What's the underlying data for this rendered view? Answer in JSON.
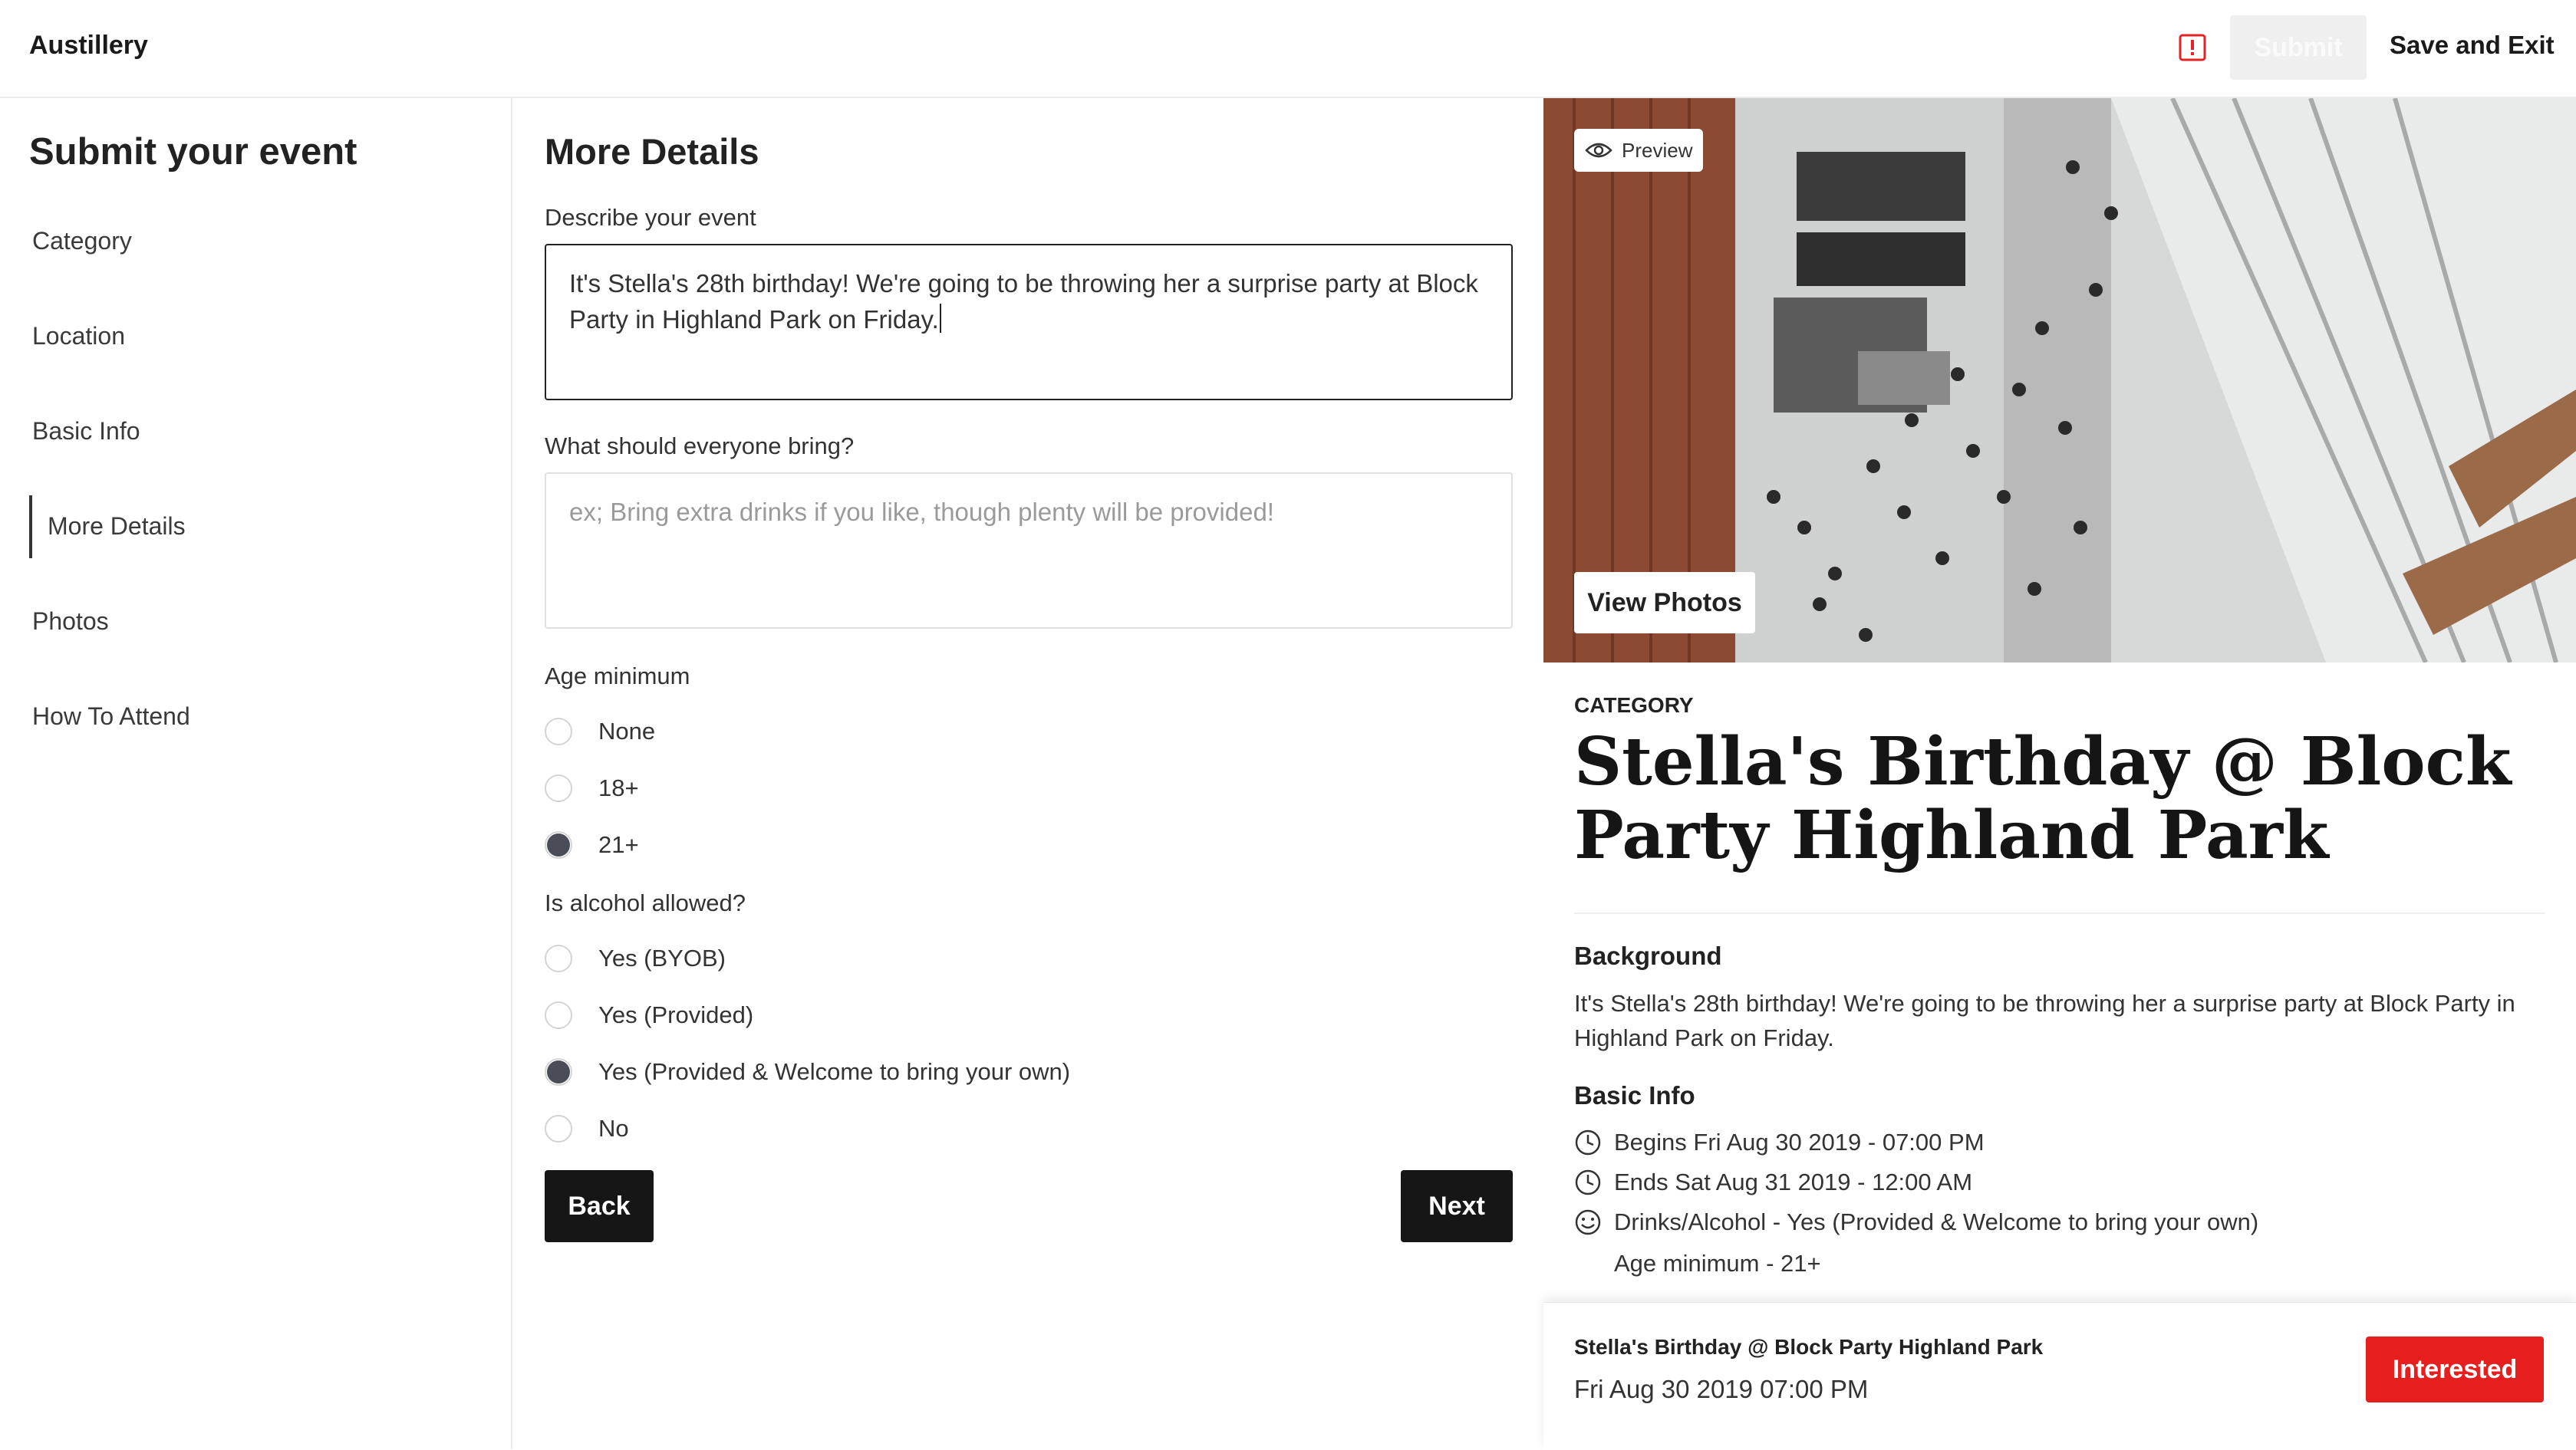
{
  "app": {
    "brand": "Austillery"
  },
  "header": {
    "submit_label": "Submit",
    "save_exit_label": "Save and Exit"
  },
  "sidebar": {
    "title": "Submit your event",
    "items": [
      {
        "label": "Category"
      },
      {
        "label": "Location"
      },
      {
        "label": "Basic Info"
      },
      {
        "label": "More Details",
        "active": true
      },
      {
        "label": "Photos"
      },
      {
        "label": "How To Attend"
      }
    ]
  },
  "form": {
    "heading": "More Details",
    "describe_label": "Describe your event",
    "describe_value": "It's Stella's 28th birthday! We're going to be throwing her a surprise party at Block Party in Highland Park on Friday.",
    "bring_label": "What should everyone bring?",
    "bring_placeholder": "ex; Bring extra drinks if you like, though plenty will be provided!",
    "age_label": "Age minimum",
    "age_options": [
      "None",
      "18+",
      "21+"
    ],
    "age_selected": "21+",
    "alcohol_label": "Is alcohol allowed?",
    "alcohol_options": [
      "Yes (BYOB)",
      "Yes (Provided)",
      "Yes (Provided & Welcome to bring your own)",
      "No"
    ],
    "alcohol_selected": "Yes (Provided & Welcome to bring your own)",
    "back_label": "Back",
    "next_label": "Next"
  },
  "preview": {
    "chip_label": "Preview",
    "view_photos_label": "View Photos",
    "category": "CATEGORY",
    "title": "Stella's Birthday @ Block Party Highland Park",
    "background_heading": "Background",
    "background_text": "It's Stella's 28th birthday! We're going to be throwing her a surprise party at Block Party in Highland Park on Friday.",
    "basic_info_heading": "Basic Info",
    "info": {
      "begins": "Begins Fri Aug 30 2019 - 07:00 PM",
      "ends": "Ends Sat Aug 31 2019 - 12:00 AM",
      "drinks": "Drinks/Alcohol - Yes (Provided & Welcome to bring your own)",
      "age": "Age minimum - 21+"
    }
  },
  "sticky": {
    "title": "Stella's Birthday @ Block Party Highland Park",
    "date": "Fri Aug 30 2019 07:00 PM",
    "interested_label": "Interested"
  },
  "colors": {
    "accent_red": "#e61e1e",
    "dark": "#161616",
    "radio_selected": "#4a4d55"
  }
}
